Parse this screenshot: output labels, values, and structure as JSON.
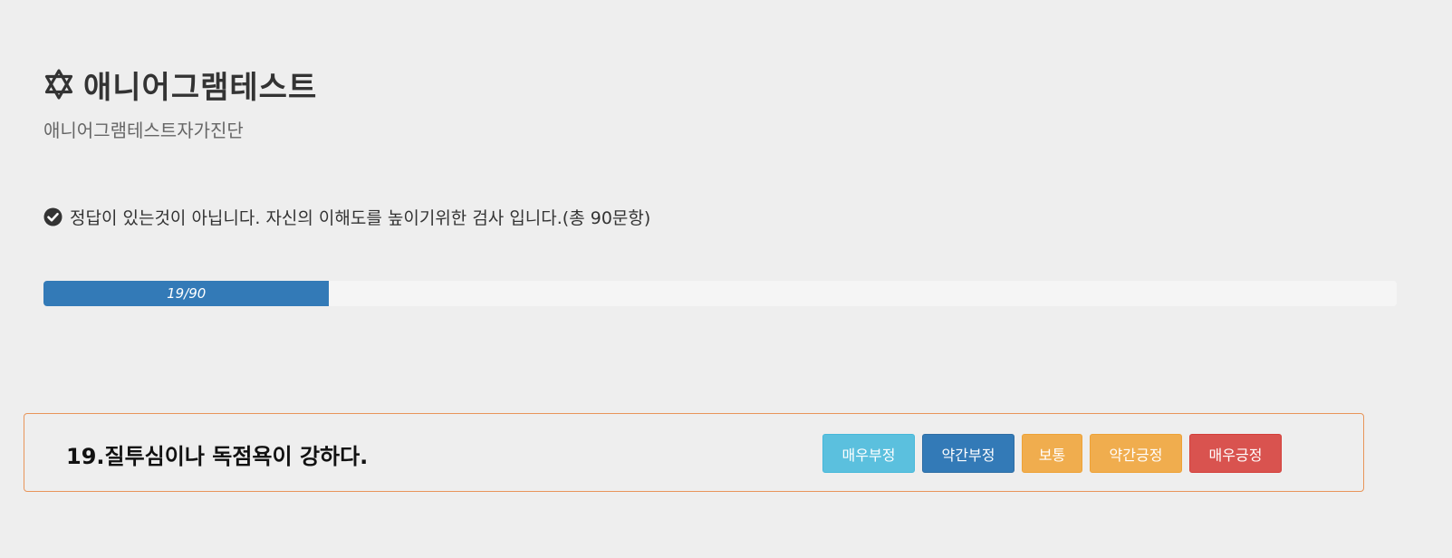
{
  "header": {
    "title": "애니어그램테스트",
    "subtitle": "애니어그램테스트자가진단",
    "title_icon": "star-of-david-icon"
  },
  "notice": {
    "icon": "check-circle-icon",
    "text": "정답이 있는것이 아닙니다. 자신의 이해도를 높이기위한 검사 입니다.(총 90문항)"
  },
  "progress": {
    "current": 19,
    "total": 90,
    "label": "19/90",
    "fraction": 0.2111,
    "bar_color": "#337ab7"
  },
  "question": {
    "text": "19.질투심이나 독점욕이 강하다.",
    "border_color": "#e8955a",
    "answers": [
      {
        "label": "매우부정",
        "color": "#5bc0de"
      },
      {
        "label": "약간부정",
        "color": "#337ab7"
      },
      {
        "label": "보통",
        "color": "#f0ad4e"
      },
      {
        "label": "약간긍정",
        "color": "#f0ad4e"
      },
      {
        "label": "매우긍정",
        "color": "#d9534f"
      }
    ]
  }
}
